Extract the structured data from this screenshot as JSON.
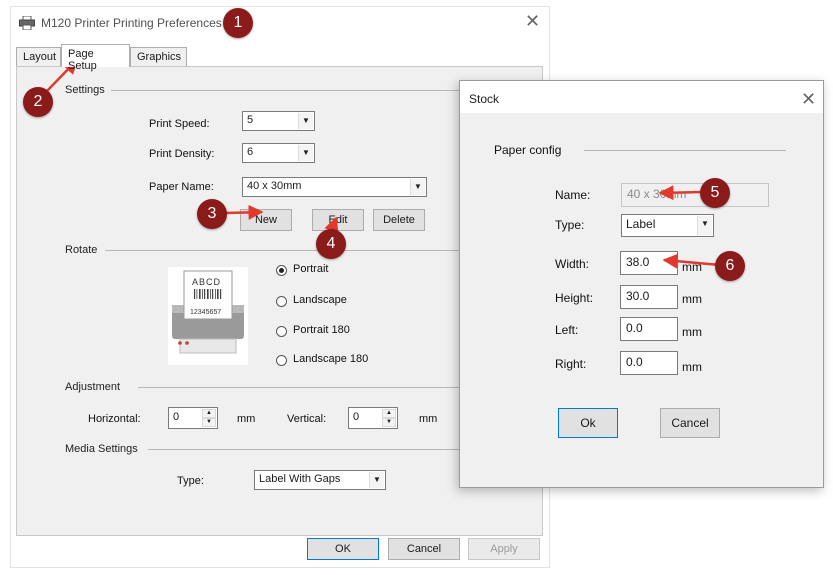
{
  "colors": {
    "marker": "#8b1a1a",
    "arrow": "#e03a2e",
    "focus_border": "#0078d7"
  },
  "main_window": {
    "title": "M120 Printer Printing Preferences",
    "icon": "printer-icon",
    "tabs": [
      {
        "label": "Layout"
      },
      {
        "label": "Page Setup"
      },
      {
        "label": "Graphics"
      }
    ],
    "active_tab": "Page Setup",
    "settings": {
      "group_label": "Settings",
      "print_speed_label": "Print Speed:",
      "print_speed_value": "5",
      "print_density_label": "Print Density:",
      "print_density_value": "6",
      "paper_name_label": "Paper Name:",
      "paper_name_value": "40 x 30mm",
      "new_button": "New",
      "edit_button": "Edit",
      "delete_button": "Delete"
    },
    "rotate": {
      "group_label": "Rotate",
      "preview_text": "ABCD",
      "preview_numbers": "12345657",
      "options": [
        {
          "label": "Portrait",
          "checked": true
        },
        {
          "label": "Landscape",
          "checked": false
        },
        {
          "label": "Portrait 180",
          "checked": false
        },
        {
          "label": "Landscape 180",
          "checked": false
        }
      ]
    },
    "adjustment": {
      "group_label": "Adjustment",
      "horizontal_label": "Horizontal:",
      "horizontal_value": "0",
      "horizontal_unit": "mm",
      "vertical_label": "Vertical:",
      "vertical_value": "0",
      "vertical_unit": "mm"
    },
    "media_settings": {
      "group_label": "Media Settings",
      "type_label": "Type:",
      "type_value": "Label With Gaps"
    },
    "footer": {
      "ok": "OK",
      "cancel": "Cancel",
      "apply": "Apply"
    }
  },
  "stock_dialog": {
    "title": "Stock",
    "group_label": "Paper config",
    "name_label": "Name:",
    "name_value": "40 x 30mm",
    "type_label": "Type:",
    "type_value": "Label",
    "width_label": "Width:",
    "width_value": "38.0",
    "width_unit": "mm",
    "height_label": "Height:",
    "height_value": "30.0",
    "height_unit": "mm",
    "left_label": "Left:",
    "left_value": "0.0",
    "left_unit": "mm",
    "right_label": "Right:",
    "right_value": "0.0",
    "right_unit": "mm",
    "ok": "Ok",
    "cancel": "Cancel"
  },
  "annotations": [
    {
      "label": "1"
    },
    {
      "label": "2"
    },
    {
      "label": "3"
    },
    {
      "label": "4"
    },
    {
      "label": "5"
    },
    {
      "label": "6"
    }
  ]
}
